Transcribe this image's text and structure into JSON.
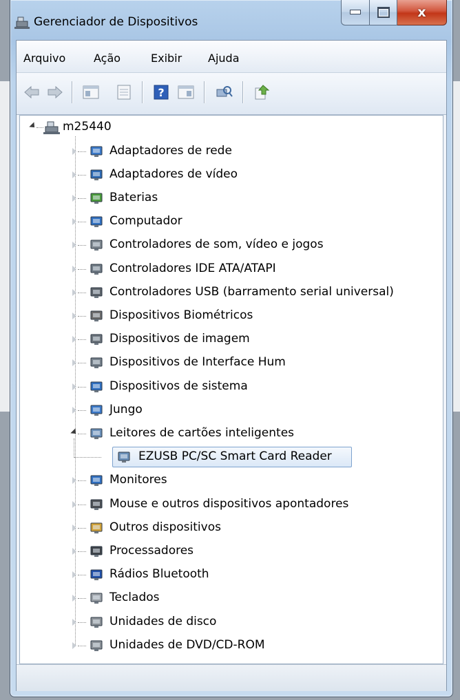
{
  "window": {
    "title": "Gerenciador de Dispositivos",
    "close_glyph": "x"
  },
  "menu": [
    "Arquivo",
    "Ação",
    "Exibir",
    "Ajuda"
  ],
  "toolbar": [
    {
      "name": "back-icon",
      "color": "#9aa7b5"
    },
    {
      "name": "forward-icon",
      "color": "#9aa7b5"
    },
    {
      "name": "show-hide-console-tree-icon",
      "color": "#6d86a3"
    },
    {
      "name": "properties-icon",
      "color": "#8aa0b8"
    },
    {
      "name": "help-icon",
      "color": "#2e5fb8"
    },
    {
      "name": "show-action-pane-icon",
      "color": "#6d86a3"
    },
    {
      "name": "scan-hardware-changes-icon",
      "color": "#4d7fb8"
    },
    {
      "name": "update-driver-icon",
      "color": "#d1a23a"
    }
  ],
  "tree": {
    "root": {
      "label": "m25440",
      "icon": "computer-icon",
      "expanded": true
    },
    "items": [
      {
        "label": "Adaptadores de rede",
        "icon": "network-adapter-icon",
        "color": "#3a78c8"
      },
      {
        "label": "Adaptadores de vídeo",
        "icon": "display-adapter-icon",
        "color": "#2d6ab4"
      },
      {
        "label": "Baterias",
        "icon": "battery-icon",
        "color": "#4a9a3a"
      },
      {
        "label": "Computador",
        "icon": "computer-icon",
        "color": "#2f6fc0"
      },
      {
        "label": "Controladores de som, vídeo e jogos",
        "icon": "speaker-icon",
        "color": "#7f8890"
      },
      {
        "label": "Controladores IDE ATA/ATAPI",
        "icon": "ide-controller-icon",
        "color": "#6f7a84"
      },
      {
        "label": "Controladores USB (barramento serial universal)",
        "icon": "usb-icon",
        "color": "#5c636a"
      },
      {
        "label": "Dispositivos Biométricos",
        "icon": "fingerprint-icon",
        "color": "#6b6b6b"
      },
      {
        "label": "Dispositivos de imagem",
        "icon": "camera-icon",
        "color": "#6b737b"
      },
      {
        "label": "Dispositivos de Interface Hum",
        "icon": "keyboard-mouse-icon",
        "color": "#76808a"
      },
      {
        "label": "Dispositivos de sistema",
        "icon": "system-device-icon",
        "color": "#2f6fc0"
      },
      {
        "label": "Jungo",
        "icon": "network-device-icon",
        "color": "#3a78c8"
      },
      {
        "label": "Leitores de cartões inteligentes",
        "icon": "smart-card-reader-icon",
        "color": "#6a8fb8",
        "expanded": true,
        "children": [
          {
            "label": "EZUSB PC/SC Smart Card Reader",
            "icon": "smart-card-reader-icon",
            "color": "#6a8fb8",
            "selected": true
          }
        ]
      },
      {
        "label": "Monitores",
        "icon": "monitor-icon",
        "color": "#2f6fc0"
      },
      {
        "label": "Mouse e outros dispositivos apontadores",
        "icon": "mouse-icon",
        "color": "#4b4f54"
      },
      {
        "label": "Outros dispositivos",
        "icon": "unknown-device-icon",
        "color": "#d1a23a"
      },
      {
        "label": "Processadores",
        "icon": "processor-icon",
        "color": "#3d4248"
      },
      {
        "label": "Rádios Bluetooth",
        "icon": "bluetooth-icon",
        "color": "#1f4fa8"
      },
      {
        "label": "Teclados",
        "icon": "keyboard-icon",
        "color": "#9aa0a6"
      },
      {
        "label": "Unidades de disco",
        "icon": "disk-drive-icon",
        "color": "#8a9096"
      },
      {
        "label": "Unidades de DVD/CD-ROM",
        "icon": "dvd-drive-icon",
        "color": "#8a9096"
      }
    ]
  }
}
